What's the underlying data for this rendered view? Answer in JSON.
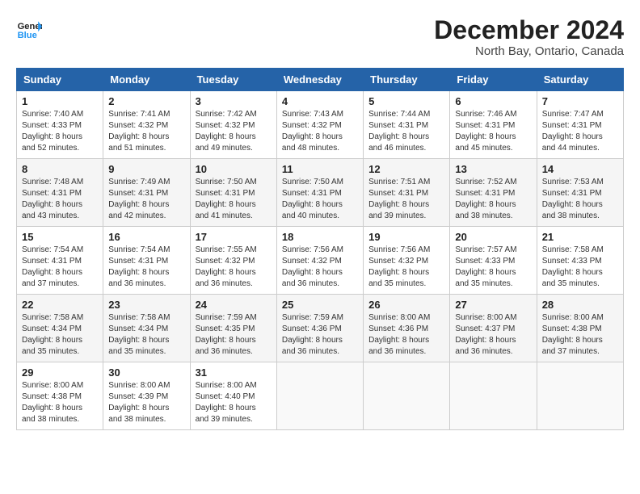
{
  "logo": {
    "line1": "General",
    "line2": "Blue"
  },
  "title": "December 2024",
  "subtitle": "North Bay, Ontario, Canada",
  "days_header": [
    "Sunday",
    "Monday",
    "Tuesday",
    "Wednesday",
    "Thursday",
    "Friday",
    "Saturday"
  ],
  "weeks": [
    [
      {
        "day": "1",
        "sunrise": "7:40 AM",
        "sunset": "4:33 PM",
        "daylight": "8 hours and 52 minutes."
      },
      {
        "day": "2",
        "sunrise": "7:41 AM",
        "sunset": "4:32 PM",
        "daylight": "8 hours and 51 minutes."
      },
      {
        "day": "3",
        "sunrise": "7:42 AM",
        "sunset": "4:32 PM",
        "daylight": "8 hours and 49 minutes."
      },
      {
        "day": "4",
        "sunrise": "7:43 AM",
        "sunset": "4:32 PM",
        "daylight": "8 hours and 48 minutes."
      },
      {
        "day": "5",
        "sunrise": "7:44 AM",
        "sunset": "4:31 PM",
        "daylight": "8 hours and 46 minutes."
      },
      {
        "day": "6",
        "sunrise": "7:46 AM",
        "sunset": "4:31 PM",
        "daylight": "8 hours and 45 minutes."
      },
      {
        "day": "7",
        "sunrise": "7:47 AM",
        "sunset": "4:31 PM",
        "daylight": "8 hours and 44 minutes."
      }
    ],
    [
      {
        "day": "8",
        "sunrise": "7:48 AM",
        "sunset": "4:31 PM",
        "daylight": "8 hours and 43 minutes."
      },
      {
        "day": "9",
        "sunrise": "7:49 AM",
        "sunset": "4:31 PM",
        "daylight": "8 hours and 42 minutes."
      },
      {
        "day": "10",
        "sunrise": "7:50 AM",
        "sunset": "4:31 PM",
        "daylight": "8 hours and 41 minutes."
      },
      {
        "day": "11",
        "sunrise": "7:50 AM",
        "sunset": "4:31 PM",
        "daylight": "8 hours and 40 minutes."
      },
      {
        "day": "12",
        "sunrise": "7:51 AM",
        "sunset": "4:31 PM",
        "daylight": "8 hours and 39 minutes."
      },
      {
        "day": "13",
        "sunrise": "7:52 AM",
        "sunset": "4:31 PM",
        "daylight": "8 hours and 38 minutes."
      },
      {
        "day": "14",
        "sunrise": "7:53 AM",
        "sunset": "4:31 PM",
        "daylight": "8 hours and 38 minutes."
      }
    ],
    [
      {
        "day": "15",
        "sunrise": "7:54 AM",
        "sunset": "4:31 PM",
        "daylight": "8 hours and 37 minutes."
      },
      {
        "day": "16",
        "sunrise": "7:54 AM",
        "sunset": "4:31 PM",
        "daylight": "8 hours and 36 minutes."
      },
      {
        "day": "17",
        "sunrise": "7:55 AM",
        "sunset": "4:32 PM",
        "daylight": "8 hours and 36 minutes."
      },
      {
        "day": "18",
        "sunrise": "7:56 AM",
        "sunset": "4:32 PM",
        "daylight": "8 hours and 36 minutes."
      },
      {
        "day": "19",
        "sunrise": "7:56 AM",
        "sunset": "4:32 PM",
        "daylight": "8 hours and 35 minutes."
      },
      {
        "day": "20",
        "sunrise": "7:57 AM",
        "sunset": "4:33 PM",
        "daylight": "8 hours and 35 minutes."
      },
      {
        "day": "21",
        "sunrise": "7:58 AM",
        "sunset": "4:33 PM",
        "daylight": "8 hours and 35 minutes."
      }
    ],
    [
      {
        "day": "22",
        "sunrise": "7:58 AM",
        "sunset": "4:34 PM",
        "daylight": "8 hours and 35 minutes."
      },
      {
        "day": "23",
        "sunrise": "7:58 AM",
        "sunset": "4:34 PM",
        "daylight": "8 hours and 35 minutes."
      },
      {
        "day": "24",
        "sunrise": "7:59 AM",
        "sunset": "4:35 PM",
        "daylight": "8 hours and 36 minutes."
      },
      {
        "day": "25",
        "sunrise": "7:59 AM",
        "sunset": "4:36 PM",
        "daylight": "8 hours and 36 minutes."
      },
      {
        "day": "26",
        "sunrise": "8:00 AM",
        "sunset": "4:36 PM",
        "daylight": "8 hours and 36 minutes."
      },
      {
        "day": "27",
        "sunrise": "8:00 AM",
        "sunset": "4:37 PM",
        "daylight": "8 hours and 36 minutes."
      },
      {
        "day": "28",
        "sunrise": "8:00 AM",
        "sunset": "4:38 PM",
        "daylight": "8 hours and 37 minutes."
      }
    ],
    [
      {
        "day": "29",
        "sunrise": "8:00 AM",
        "sunset": "4:38 PM",
        "daylight": "8 hours and 38 minutes."
      },
      {
        "day": "30",
        "sunrise": "8:00 AM",
        "sunset": "4:39 PM",
        "daylight": "8 hours and 38 minutes."
      },
      {
        "day": "31",
        "sunrise": "8:00 AM",
        "sunset": "4:40 PM",
        "daylight": "8 hours and 39 minutes."
      },
      null,
      null,
      null,
      null
    ]
  ]
}
